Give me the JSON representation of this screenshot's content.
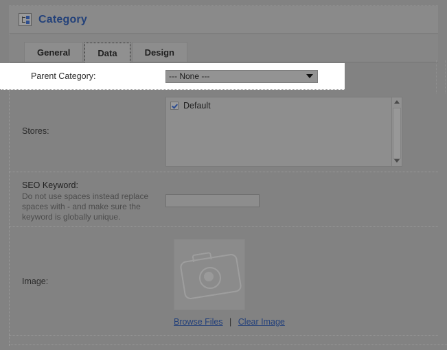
{
  "window": {
    "title": "Category",
    "icon": "category-tree-icon"
  },
  "tabs": [
    {
      "label": "General",
      "active": false
    },
    {
      "label": "Data",
      "active": true
    },
    {
      "label": "Design",
      "active": false
    }
  ],
  "form": {
    "parent_category": {
      "label": "Parent Category:",
      "selected_value": "--- None ---",
      "caret_icon": "chevron-down-icon"
    },
    "stores": {
      "label": "Stores:",
      "items": [
        {
          "label": "Default",
          "checked": true
        }
      ],
      "scrollbar": {
        "up_icon": "scroll-up-arrow-icon",
        "down_icon": "scroll-down-arrow-icon"
      }
    },
    "seo_keyword": {
      "label": "SEO Keyword:",
      "hint": "Do not use spaces instead replace spaces with - and make sure the keyword is globally unique.",
      "value": "",
      "placeholder": ""
    },
    "image": {
      "label": "Image:",
      "placeholder_icon": "camera-placeholder-icon",
      "browse_link": "Browse Files",
      "separator": "|",
      "clear_link": "Clear Image"
    }
  },
  "colors": {
    "page_background": "#828282",
    "header_title": "#24427a",
    "link": "#23407a",
    "highlight_row": "#ffffff",
    "checkbox_check": "#2a4a90"
  }
}
